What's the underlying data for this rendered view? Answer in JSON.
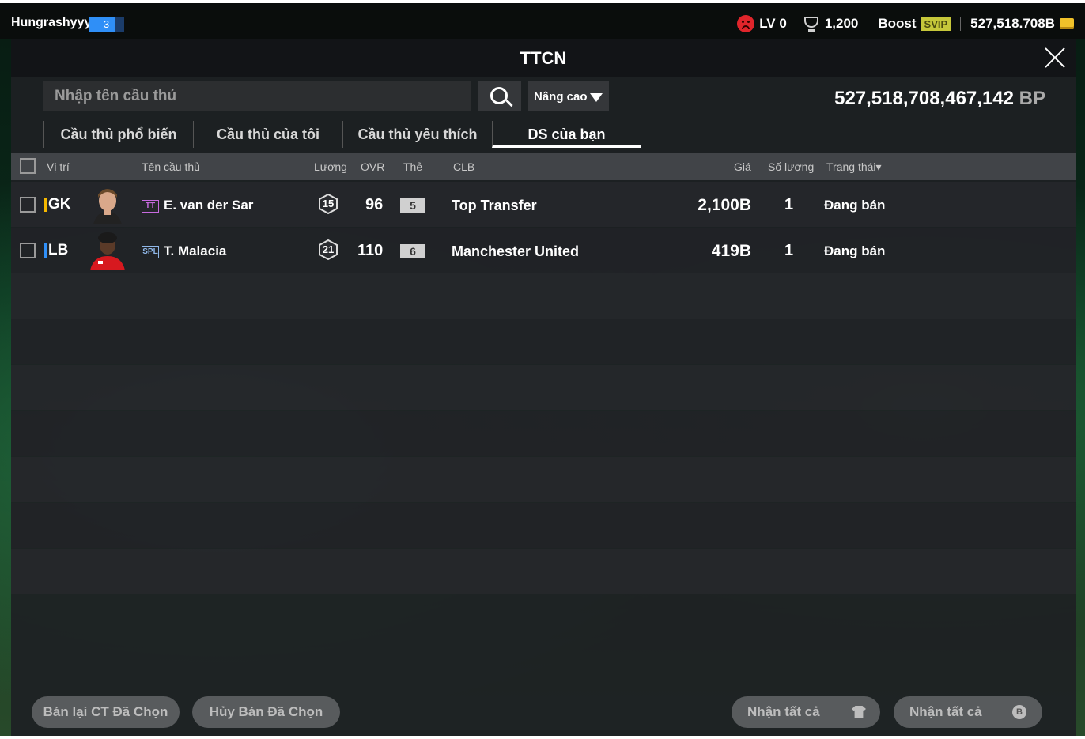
{
  "topbar": {
    "username": "Hungrashyyy",
    "level_badge": "3",
    "lv": "LV 0",
    "trophies": "1,200",
    "boost": "Boost",
    "svip": "SVIP",
    "currency": "527,518.708B"
  },
  "modal": {
    "title": "TTCN",
    "search_placeholder": "Nhập tên cầu thủ",
    "advanced_label": "Nâng cao",
    "bp_value": "527,518,708,467,142",
    "bp_unit": "BP",
    "tabs": [
      "Cầu thủ phổ biến",
      "Cầu thủ của tôi",
      "Cầu thủ yêu thích",
      "DS của bạn"
    ],
    "active_tab": "DS của bạn"
  },
  "table": {
    "headers": {
      "position": "Vị trí",
      "name": "Tên cầu thủ",
      "salary": "Lương",
      "ovr": "OVR",
      "card": "Thẻ",
      "club": "CLB",
      "price": "Giá",
      "qty": "Số lượng",
      "status": "Trạng thái▾"
    },
    "rows": [
      {
        "position": "GK",
        "position_color": "#f5b800",
        "season": "TT",
        "season_color": "#c76adf",
        "name": "E. van der Sar",
        "salary": "15",
        "ovr": "96",
        "card": "5",
        "club": "Top Transfer",
        "price": "2,100B",
        "qty": "1",
        "status": "Đang bán"
      },
      {
        "position": "LB",
        "position_color": "#2f8ff7",
        "season": "SPL",
        "season_color": "#8fb7e8",
        "name": "T. Malacia",
        "salary": "21",
        "ovr": "110",
        "card": "6",
        "club": "Manchester United",
        "price": "419B",
        "qty": "1",
        "status": "Đang bán"
      }
    ]
  },
  "footer": {
    "resell_selected": "Bán lại CT Đã Chọn",
    "cancel_selected": "Hủy Bán Đã Chọn",
    "claim_all_players": "Nhận tất cả",
    "claim_all_bp": "Nhận tất cả"
  }
}
